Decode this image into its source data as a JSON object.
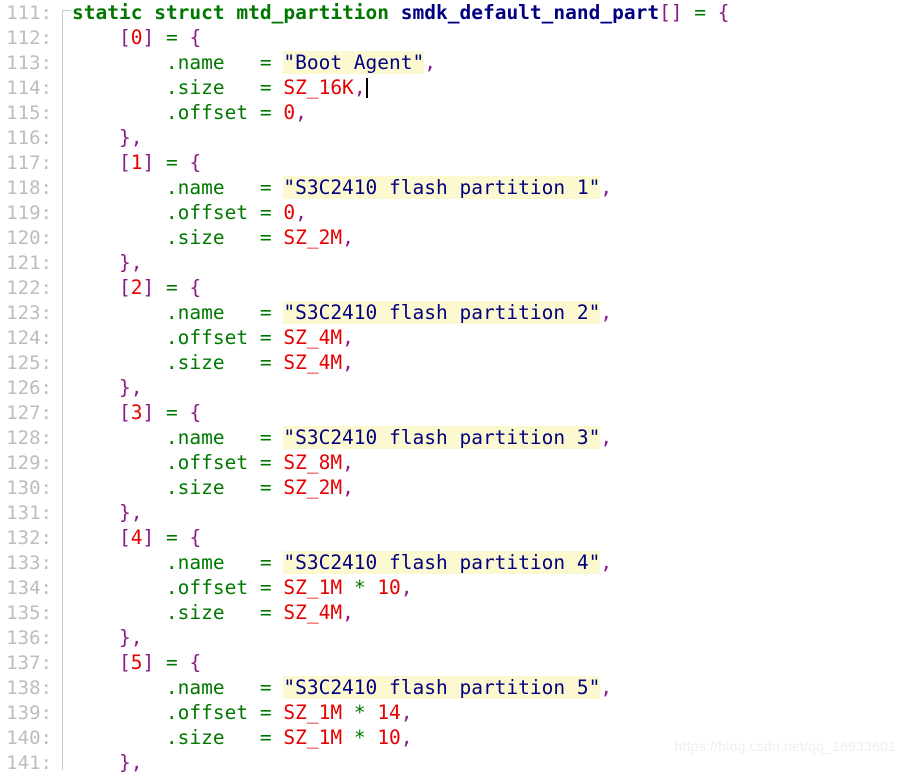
{
  "editor": {
    "language": "c",
    "background_color": "#ffffff",
    "gutter_color": "#bdbdbd",
    "fold_rail_color": "#c8c8c8",
    "highlight_color": "#fcf8cf",
    "first_line": 111,
    "last_line": 141,
    "caret_line": 114
  },
  "colors": {
    "keyword": "#007800",
    "identifier": "#000080",
    "bracket": "#8a1a8a",
    "operator": "#007800",
    "number": "#e60000",
    "constant": "#e60000",
    "field": "#007800",
    "string": "#000080",
    "string_highlight": "#fcf8cf",
    "plain": "#000000",
    "line_number": "#bdbdbd"
  },
  "lines": [
    {
      "n": "111",
      "tokens": [
        {
          "t": "static",
          "c": "t-kw"
        },
        {
          "t": " ",
          "c": "t-plain"
        },
        {
          "t": "struct",
          "c": "t-kw"
        },
        {
          "t": " ",
          "c": "t-plain"
        },
        {
          "t": "mtd_partition",
          "c": "t-type"
        },
        {
          "t": " ",
          "c": "t-plain"
        },
        {
          "t": "smdk_default_nand_part",
          "c": "t-ident"
        },
        {
          "t": "[]",
          "c": "t-brk"
        },
        {
          "t": " ",
          "c": "t-plain"
        },
        {
          "t": "=",
          "c": "t-op"
        },
        {
          "t": " ",
          "c": "t-plain"
        },
        {
          "t": "{",
          "c": "t-brk"
        }
      ]
    },
    {
      "n": "112",
      "tokens": [
        {
          "t": "    ",
          "c": "t-plain"
        },
        {
          "t": "[",
          "c": "t-brk"
        },
        {
          "t": "0",
          "c": "t-num"
        },
        {
          "t": "]",
          "c": "t-brk"
        },
        {
          "t": " ",
          "c": "t-plain"
        },
        {
          "t": "=",
          "c": "t-op"
        },
        {
          "t": " ",
          "c": "t-plain"
        },
        {
          "t": "{",
          "c": "t-brk"
        }
      ]
    },
    {
      "n": "113",
      "tokens": [
        {
          "t": "        ",
          "c": "t-plain"
        },
        {
          "t": ".name",
          "c": "t-field"
        },
        {
          "t": "   ",
          "c": "t-plain"
        },
        {
          "t": "=",
          "c": "t-op"
        },
        {
          "t": " ",
          "c": "t-plain"
        },
        {
          "t": "\"Boot Agent\"",
          "c": "t-str"
        },
        {
          "t": ",",
          "c": "t-punct"
        }
      ]
    },
    {
      "n": "114",
      "tokens": [
        {
          "t": "        ",
          "c": "t-plain"
        },
        {
          "t": ".size",
          "c": "t-field"
        },
        {
          "t": "   ",
          "c": "t-plain"
        },
        {
          "t": "=",
          "c": "t-op"
        },
        {
          "t": " ",
          "c": "t-plain"
        },
        {
          "t": "SZ_16K",
          "c": "t-const"
        },
        {
          "t": ",",
          "c": "t-punct"
        }
      ],
      "caret": true
    },
    {
      "n": "115",
      "tokens": [
        {
          "t": "        ",
          "c": "t-plain"
        },
        {
          "t": ".offset",
          "c": "t-field"
        },
        {
          "t": " ",
          "c": "t-plain"
        },
        {
          "t": "=",
          "c": "t-op"
        },
        {
          "t": " ",
          "c": "t-plain"
        },
        {
          "t": "0",
          "c": "t-num"
        },
        {
          "t": ",",
          "c": "t-punct"
        }
      ]
    },
    {
      "n": "116",
      "tokens": [
        {
          "t": "    ",
          "c": "t-plain"
        },
        {
          "t": "}",
          "c": "t-brk"
        },
        {
          "t": ",",
          "c": "t-punct"
        }
      ]
    },
    {
      "n": "117",
      "tokens": [
        {
          "t": "    ",
          "c": "t-plain"
        },
        {
          "t": "[",
          "c": "t-brk"
        },
        {
          "t": "1",
          "c": "t-num"
        },
        {
          "t": "]",
          "c": "t-brk"
        },
        {
          "t": " ",
          "c": "t-plain"
        },
        {
          "t": "=",
          "c": "t-op"
        },
        {
          "t": " ",
          "c": "t-plain"
        },
        {
          "t": "{",
          "c": "t-brk"
        }
      ]
    },
    {
      "n": "118",
      "tokens": [
        {
          "t": "        ",
          "c": "t-plain"
        },
        {
          "t": ".name",
          "c": "t-field"
        },
        {
          "t": "   ",
          "c": "t-plain"
        },
        {
          "t": "=",
          "c": "t-op"
        },
        {
          "t": " ",
          "c": "t-plain"
        },
        {
          "t": "\"S3C2410 flash partition 1\"",
          "c": "t-str"
        },
        {
          "t": ",",
          "c": "t-punct"
        }
      ]
    },
    {
      "n": "119",
      "tokens": [
        {
          "t": "        ",
          "c": "t-plain"
        },
        {
          "t": ".offset",
          "c": "t-field"
        },
        {
          "t": " ",
          "c": "t-plain"
        },
        {
          "t": "=",
          "c": "t-op"
        },
        {
          "t": " ",
          "c": "t-plain"
        },
        {
          "t": "0",
          "c": "t-num"
        },
        {
          "t": ",",
          "c": "t-punct"
        }
      ]
    },
    {
      "n": "120",
      "tokens": [
        {
          "t": "        ",
          "c": "t-plain"
        },
        {
          "t": ".size",
          "c": "t-field"
        },
        {
          "t": "   ",
          "c": "t-plain"
        },
        {
          "t": "=",
          "c": "t-op"
        },
        {
          "t": " ",
          "c": "t-plain"
        },
        {
          "t": "SZ_2M",
          "c": "t-const"
        },
        {
          "t": ",",
          "c": "t-punct"
        }
      ]
    },
    {
      "n": "121",
      "tokens": [
        {
          "t": "    ",
          "c": "t-plain"
        },
        {
          "t": "}",
          "c": "t-brk"
        },
        {
          "t": ",",
          "c": "t-punct"
        }
      ]
    },
    {
      "n": "122",
      "tokens": [
        {
          "t": "    ",
          "c": "t-plain"
        },
        {
          "t": "[",
          "c": "t-brk"
        },
        {
          "t": "2",
          "c": "t-num"
        },
        {
          "t": "]",
          "c": "t-brk"
        },
        {
          "t": " ",
          "c": "t-plain"
        },
        {
          "t": "=",
          "c": "t-op"
        },
        {
          "t": " ",
          "c": "t-plain"
        },
        {
          "t": "{",
          "c": "t-brk"
        }
      ]
    },
    {
      "n": "123",
      "tokens": [
        {
          "t": "        ",
          "c": "t-plain"
        },
        {
          "t": ".name",
          "c": "t-field"
        },
        {
          "t": "   ",
          "c": "t-plain"
        },
        {
          "t": "=",
          "c": "t-op"
        },
        {
          "t": " ",
          "c": "t-plain"
        },
        {
          "t": "\"S3C2410 flash partition 2\"",
          "c": "t-str"
        },
        {
          "t": ",",
          "c": "t-punct"
        }
      ]
    },
    {
      "n": "124",
      "tokens": [
        {
          "t": "        ",
          "c": "t-plain"
        },
        {
          "t": ".offset",
          "c": "t-field"
        },
        {
          "t": " ",
          "c": "t-plain"
        },
        {
          "t": "=",
          "c": "t-op"
        },
        {
          "t": " ",
          "c": "t-plain"
        },
        {
          "t": "SZ_4M",
          "c": "t-const"
        },
        {
          "t": ",",
          "c": "t-punct"
        }
      ]
    },
    {
      "n": "125",
      "tokens": [
        {
          "t": "        ",
          "c": "t-plain"
        },
        {
          "t": ".size",
          "c": "t-field"
        },
        {
          "t": "   ",
          "c": "t-plain"
        },
        {
          "t": "=",
          "c": "t-op"
        },
        {
          "t": " ",
          "c": "t-plain"
        },
        {
          "t": "SZ_4M",
          "c": "t-const"
        },
        {
          "t": ",",
          "c": "t-punct"
        }
      ]
    },
    {
      "n": "126",
      "tokens": [
        {
          "t": "    ",
          "c": "t-plain"
        },
        {
          "t": "}",
          "c": "t-brk"
        },
        {
          "t": ",",
          "c": "t-punct"
        }
      ]
    },
    {
      "n": "127",
      "tokens": [
        {
          "t": "    ",
          "c": "t-plain"
        },
        {
          "t": "[",
          "c": "t-brk"
        },
        {
          "t": "3",
          "c": "t-num"
        },
        {
          "t": "]",
          "c": "t-brk"
        },
        {
          "t": " ",
          "c": "t-plain"
        },
        {
          "t": "=",
          "c": "t-op"
        },
        {
          "t": " ",
          "c": "t-plain"
        },
        {
          "t": "{",
          "c": "t-brk"
        }
      ]
    },
    {
      "n": "128",
      "tokens": [
        {
          "t": "        ",
          "c": "t-plain"
        },
        {
          "t": ".name",
          "c": "t-field"
        },
        {
          "t": "   ",
          "c": "t-plain"
        },
        {
          "t": "=",
          "c": "t-op"
        },
        {
          "t": " ",
          "c": "t-plain"
        },
        {
          "t": "\"S3C2410 flash partition 3\"",
          "c": "t-str"
        },
        {
          "t": ",",
          "c": "t-punct"
        }
      ]
    },
    {
      "n": "129",
      "tokens": [
        {
          "t": "        ",
          "c": "t-plain"
        },
        {
          "t": ".offset",
          "c": "t-field"
        },
        {
          "t": " ",
          "c": "t-plain"
        },
        {
          "t": "=",
          "c": "t-op"
        },
        {
          "t": " ",
          "c": "t-plain"
        },
        {
          "t": "SZ_8M",
          "c": "t-const"
        },
        {
          "t": ",",
          "c": "t-punct"
        }
      ]
    },
    {
      "n": "130",
      "tokens": [
        {
          "t": "        ",
          "c": "t-plain"
        },
        {
          "t": ".size",
          "c": "t-field"
        },
        {
          "t": "   ",
          "c": "t-plain"
        },
        {
          "t": "=",
          "c": "t-op"
        },
        {
          "t": " ",
          "c": "t-plain"
        },
        {
          "t": "SZ_2M",
          "c": "t-const"
        },
        {
          "t": ",",
          "c": "t-punct"
        }
      ]
    },
    {
      "n": "131",
      "tokens": [
        {
          "t": "    ",
          "c": "t-plain"
        },
        {
          "t": "}",
          "c": "t-brk"
        },
        {
          "t": ",",
          "c": "t-punct"
        }
      ]
    },
    {
      "n": "132",
      "tokens": [
        {
          "t": "    ",
          "c": "t-plain"
        },
        {
          "t": "[",
          "c": "t-brk"
        },
        {
          "t": "4",
          "c": "t-num"
        },
        {
          "t": "]",
          "c": "t-brk"
        },
        {
          "t": " ",
          "c": "t-plain"
        },
        {
          "t": "=",
          "c": "t-op"
        },
        {
          "t": " ",
          "c": "t-plain"
        },
        {
          "t": "{",
          "c": "t-brk"
        }
      ]
    },
    {
      "n": "133",
      "tokens": [
        {
          "t": "        ",
          "c": "t-plain"
        },
        {
          "t": ".name",
          "c": "t-field"
        },
        {
          "t": "   ",
          "c": "t-plain"
        },
        {
          "t": "=",
          "c": "t-op"
        },
        {
          "t": " ",
          "c": "t-plain"
        },
        {
          "t": "\"S3C2410 flash partition 4\"",
          "c": "t-str"
        },
        {
          "t": ",",
          "c": "t-punct"
        }
      ]
    },
    {
      "n": "134",
      "tokens": [
        {
          "t": "        ",
          "c": "t-plain"
        },
        {
          "t": ".offset",
          "c": "t-field"
        },
        {
          "t": " ",
          "c": "t-plain"
        },
        {
          "t": "=",
          "c": "t-op"
        },
        {
          "t": " ",
          "c": "t-plain"
        },
        {
          "t": "SZ_1M",
          "c": "t-const"
        },
        {
          "t": " ",
          "c": "t-plain"
        },
        {
          "t": "*",
          "c": "t-op"
        },
        {
          "t": " ",
          "c": "t-plain"
        },
        {
          "t": "10",
          "c": "t-num"
        },
        {
          "t": ",",
          "c": "t-punct"
        }
      ]
    },
    {
      "n": "135",
      "tokens": [
        {
          "t": "        ",
          "c": "t-plain"
        },
        {
          "t": ".size",
          "c": "t-field"
        },
        {
          "t": "   ",
          "c": "t-plain"
        },
        {
          "t": "=",
          "c": "t-op"
        },
        {
          "t": " ",
          "c": "t-plain"
        },
        {
          "t": "SZ_4M",
          "c": "t-const"
        },
        {
          "t": ",",
          "c": "t-punct"
        }
      ]
    },
    {
      "n": "136",
      "tokens": [
        {
          "t": "    ",
          "c": "t-plain"
        },
        {
          "t": "}",
          "c": "t-brk"
        },
        {
          "t": ",",
          "c": "t-punct"
        }
      ]
    },
    {
      "n": "137",
      "tokens": [
        {
          "t": "    ",
          "c": "t-plain"
        },
        {
          "t": "[",
          "c": "t-brk"
        },
        {
          "t": "5",
          "c": "t-num"
        },
        {
          "t": "]",
          "c": "t-brk"
        },
        {
          "t": " ",
          "c": "t-plain"
        },
        {
          "t": "=",
          "c": "t-op"
        },
        {
          "t": " ",
          "c": "t-plain"
        },
        {
          "t": "{",
          "c": "t-brk"
        }
      ]
    },
    {
      "n": "138",
      "tokens": [
        {
          "t": "        ",
          "c": "t-plain"
        },
        {
          "t": ".name",
          "c": "t-field"
        },
        {
          "t": "   ",
          "c": "t-plain"
        },
        {
          "t": "=",
          "c": "t-op"
        },
        {
          "t": " ",
          "c": "t-plain"
        },
        {
          "t": "\"S3C2410 flash partition 5\"",
          "c": "t-str"
        },
        {
          "t": ",",
          "c": "t-punct"
        }
      ]
    },
    {
      "n": "139",
      "tokens": [
        {
          "t": "        ",
          "c": "t-plain"
        },
        {
          "t": ".offset",
          "c": "t-field"
        },
        {
          "t": " ",
          "c": "t-plain"
        },
        {
          "t": "=",
          "c": "t-op"
        },
        {
          "t": " ",
          "c": "t-plain"
        },
        {
          "t": "SZ_1M",
          "c": "t-const"
        },
        {
          "t": " ",
          "c": "t-plain"
        },
        {
          "t": "*",
          "c": "t-op"
        },
        {
          "t": " ",
          "c": "t-plain"
        },
        {
          "t": "14",
          "c": "t-num"
        },
        {
          "t": ",",
          "c": "t-punct"
        }
      ]
    },
    {
      "n": "140",
      "tokens": [
        {
          "t": "        ",
          "c": "t-plain"
        },
        {
          "t": ".size",
          "c": "t-field"
        },
        {
          "t": "   ",
          "c": "t-plain"
        },
        {
          "t": "=",
          "c": "t-op"
        },
        {
          "t": " ",
          "c": "t-plain"
        },
        {
          "t": "SZ_1M",
          "c": "t-const"
        },
        {
          "t": " ",
          "c": "t-plain"
        },
        {
          "t": "*",
          "c": "t-op"
        },
        {
          "t": " ",
          "c": "t-plain"
        },
        {
          "t": "10",
          "c": "t-num"
        },
        {
          "t": ",",
          "c": "t-punct"
        }
      ]
    },
    {
      "n": "141",
      "tokens": [
        {
          "t": "    ",
          "c": "t-plain"
        },
        {
          "t": "}",
          "c": "t-brk"
        },
        {
          "t": ",",
          "c": "t-punct"
        }
      ]
    }
  ],
  "watermark": {
    "text": "https://blog.csdn.net/qq_16933601"
  }
}
